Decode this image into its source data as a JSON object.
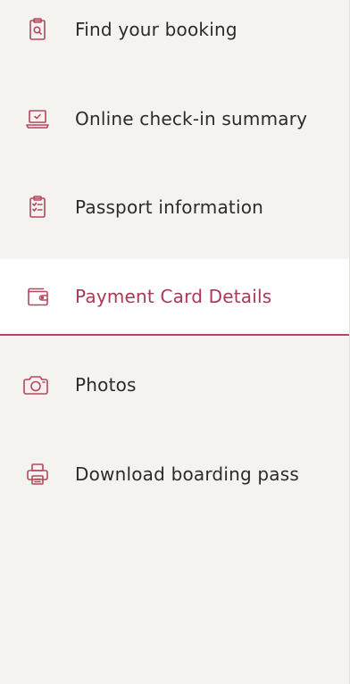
{
  "colors": {
    "accent": "#a83a55",
    "icon": "#b5475e",
    "text": "#2b2b2b",
    "background": "#f5f3ef",
    "active_background": "#ffffff"
  },
  "nav": {
    "items": [
      {
        "label": "Find your booking",
        "icon": "clipboard-search-icon",
        "active": false
      },
      {
        "label": "Online check-in summary",
        "icon": "laptop-check-icon",
        "active": false
      },
      {
        "label": "Passport information",
        "icon": "clipboard-checklist-icon",
        "active": false
      },
      {
        "label": "Payment Card Details",
        "icon": "wallet-icon",
        "active": true
      },
      {
        "label": "Photos",
        "icon": "camera-icon",
        "active": false
      },
      {
        "label": "Download boarding pass",
        "icon": "printer-icon",
        "active": false
      }
    ]
  }
}
